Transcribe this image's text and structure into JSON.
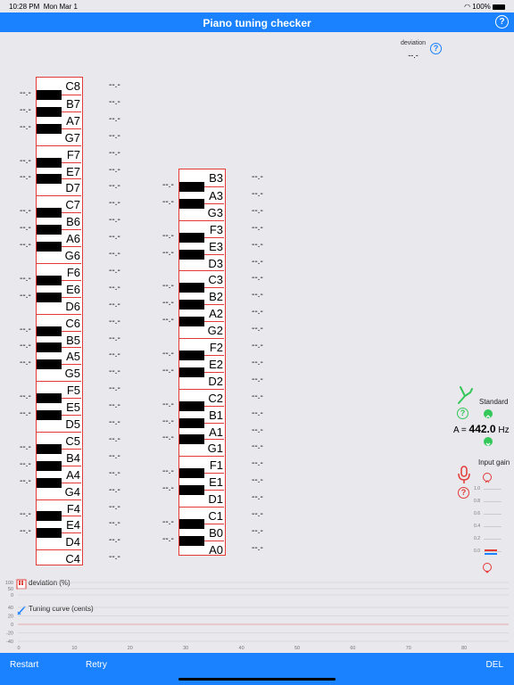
{
  "status": {
    "time": "10:28 PM",
    "date": "Mon Mar 1",
    "battery": "100%"
  },
  "header": {
    "title": "Piano tuning checker",
    "help": "?"
  },
  "deviation": {
    "label": "deviation",
    "value": "--.-"
  },
  "placeholder": "--.-",
  "piano_left": {
    "white_keys": [
      "C8",
      "B7",
      "A7",
      "G7",
      "F7",
      "E7",
      "D7",
      "C7",
      "B6",
      "A6",
      "G6",
      "F6",
      "E6",
      "D6",
      "C6",
      "B5",
      "A5",
      "G5",
      "F5",
      "E5",
      "D5",
      "C5",
      "B4",
      "A4",
      "G4",
      "F4",
      "E4",
      "D4",
      "C4"
    ]
  },
  "piano_right": {
    "white_keys": [
      "B3",
      "A3",
      "G3",
      "F3",
      "E3",
      "D3",
      "C3",
      "B2",
      "A2",
      "G2",
      "F2",
      "E2",
      "D2",
      "C2",
      "B1",
      "A1",
      "G1",
      "F1",
      "E1",
      "D1",
      "C1",
      "B0",
      "A0"
    ]
  },
  "standard": {
    "label": "Standard",
    "prefix": "A =",
    "value": "442.0",
    "unit": "Hz"
  },
  "input_gain": {
    "label": "Input gain",
    "scale": [
      "1.0",
      "0.8",
      "0.6",
      "0.4",
      "0.2",
      "0.0"
    ]
  },
  "chart_data": [
    {
      "type": "line",
      "title": "deviation (%)",
      "yticks": [
        "100",
        "50",
        "0"
      ],
      "series": []
    },
    {
      "type": "line",
      "title": "Tuning curve (cents)",
      "yticks": [
        "40",
        "20",
        "0",
        "-20",
        "-40"
      ],
      "xticks": [
        "0",
        "10",
        "20",
        "30",
        "40",
        "50",
        "60",
        "70",
        "80"
      ],
      "series": []
    }
  ],
  "toolbar": {
    "restart": "Restart",
    "retry": "Retry",
    "del": "DEL"
  },
  "colors": {
    "accent": "#1a82ff",
    "key_border": "#e53935",
    "standard_green": "#34c759"
  }
}
